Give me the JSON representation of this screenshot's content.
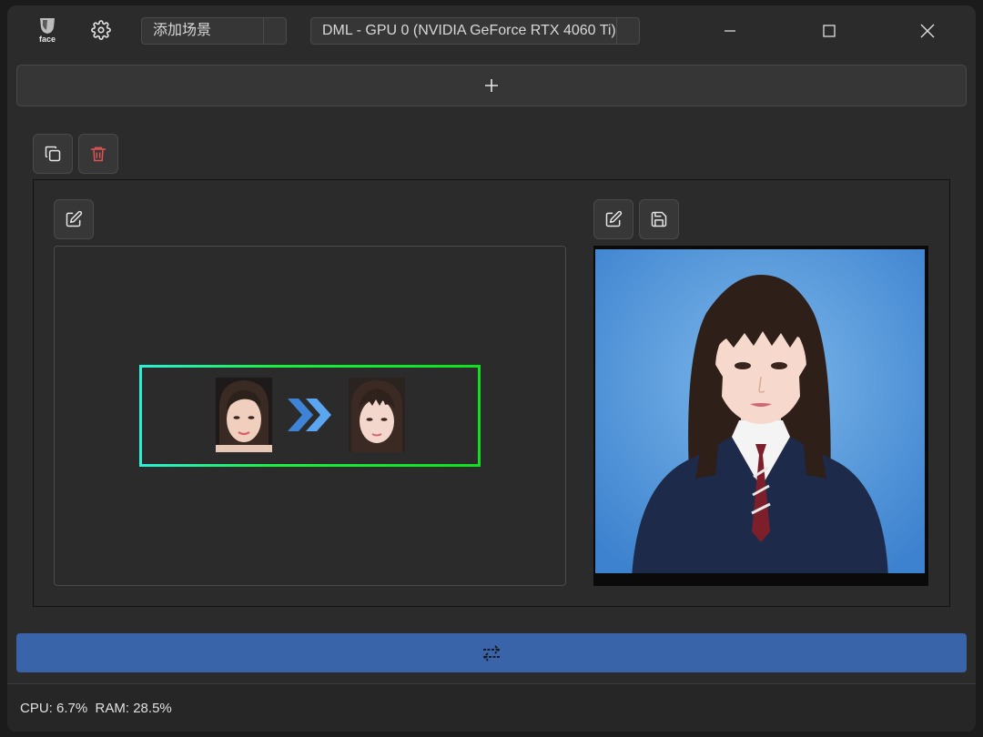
{
  "titlebar": {
    "logo_text": "face",
    "scene_selector": {
      "value": "添加场景"
    },
    "device_selector": {
      "value": "DML - GPU 0 (NVIDIA GeForce RTX 4060 Ti)"
    },
    "controls": [
      "minimize",
      "maximize",
      "close"
    ]
  },
  "toolbar": {
    "add_scene_icon": "plus-icon"
  },
  "scene_actions": {
    "copy_icon": "copy-icon",
    "delete_icon": "trash-icon",
    "delete_color": "#e05252"
  },
  "face_pair": {
    "arrow_icon": "double-chevron-right-icon",
    "frame_colors": [
      "#2af0d8",
      "#10e020"
    ]
  },
  "target_actions": {
    "edit_icon": "edit-icon",
    "save_icon": "save-icon"
  },
  "swap_button": {
    "icon": "swap-arrows-icon",
    "color": "#3964aa"
  },
  "status": {
    "cpu": "CPU: 6.7%",
    "ram": "RAM: 28.5%"
  }
}
